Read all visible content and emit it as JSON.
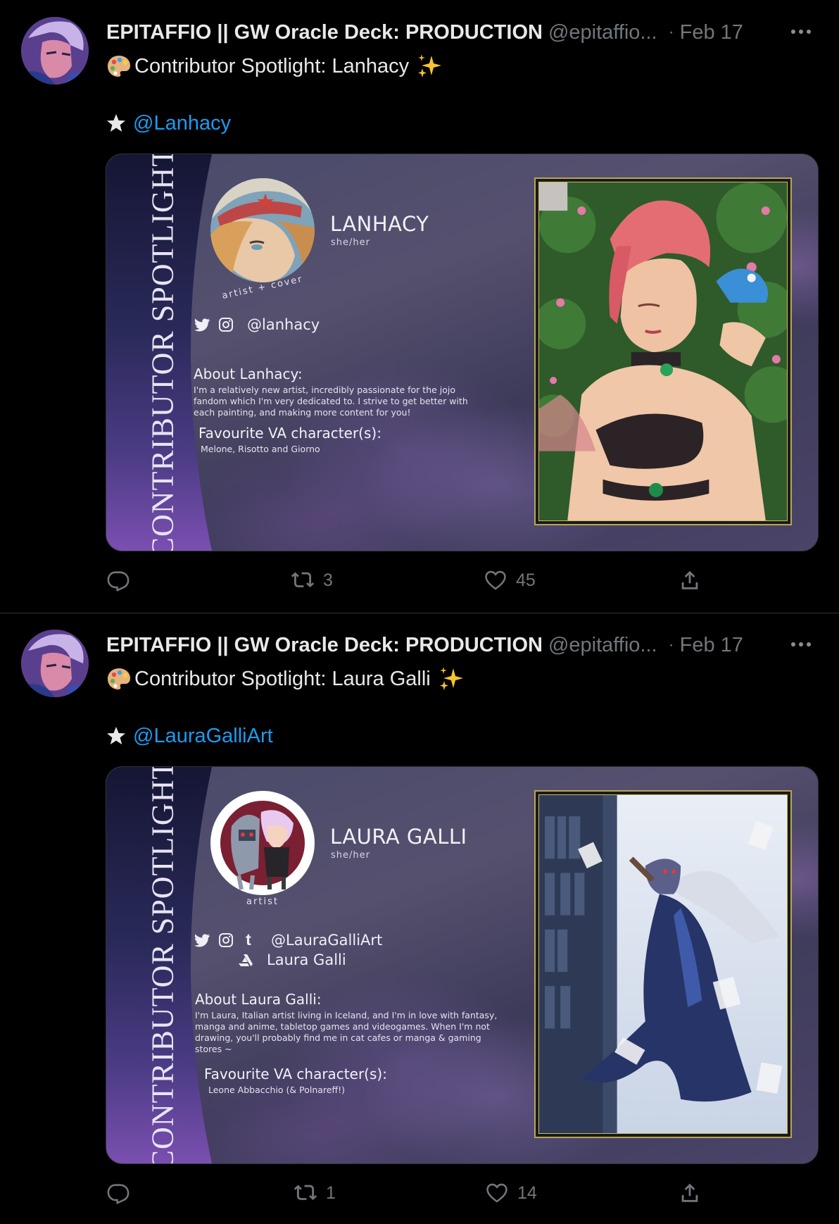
{
  "tweets": [
    {
      "author_name": "EPITAFFIO || GW Oracle Deck: PRODUCTION",
      "author_handle": "@epitaffio...",
      "separator": "·",
      "date": "Feb 17",
      "headline": "Contributor Spotlight: Lanhacy",
      "mention": "@Lanhacy",
      "card": {
        "banner": "CONTRIBUTOR SPOTLIGHT",
        "name": "LANHACY",
        "pronouns": "she/her",
        "role": "artist + cover",
        "social_handle": "@lanhacy",
        "about_title": "About Lanhacy:",
        "about_body": "I'm a relatively new artist, incredibly passionate for the jojo fandom which I'm very dedicated to. I strive to get better with each painting, and making more content for you!",
        "fav_title": "Favourite VA character(s):",
        "fav_body": "Melone, Risotto and Giorno"
      },
      "retweets": "3",
      "likes": "45"
    },
    {
      "author_name": "EPITAFFIO || GW Oracle Deck: PRODUCTION",
      "author_handle": "@epitaffio...",
      "separator": "·",
      "date": "Feb 17",
      "headline": "Contributor Spotlight: Laura Galli",
      "mention": "@LauraGalliArt",
      "card": {
        "banner": "CONTRIBUTOR SPOTLIGHT",
        "name": "LAURA GALLI",
        "pronouns": "she/her",
        "role": "artist",
        "social_handle": "@LauraGalliArt",
        "social_name": "Laura Galli",
        "about_title": "About Laura Galli:",
        "about_body": "I'm Laura, Italian artist living in Iceland, and I'm in love with fantasy, manga and anime, tabletop games and videogames. When I'm not drawing, you'll probably find me in cat cafes or manga & gaming stores ~",
        "fav_title": "Favourite VA character(s):",
        "fav_body": "Leone Abbacchio (& Polnareff!)"
      },
      "retweets": "1",
      "likes": "14"
    }
  ],
  "colors": {
    "background": "#000000",
    "text": "#e7e9ea",
    "secondary": "#71767b",
    "link": "#1d9bf0",
    "divider": "#2f3336",
    "frame_gold": "#b7a655"
  },
  "icons": [
    "palette-icon",
    "sparkles-icon",
    "star-icon",
    "reply-icon",
    "retweet-icon",
    "like-icon",
    "share-icon",
    "more-icon",
    "twitter-icon",
    "instagram-icon",
    "tumblr-icon",
    "artstation-icon"
  ]
}
